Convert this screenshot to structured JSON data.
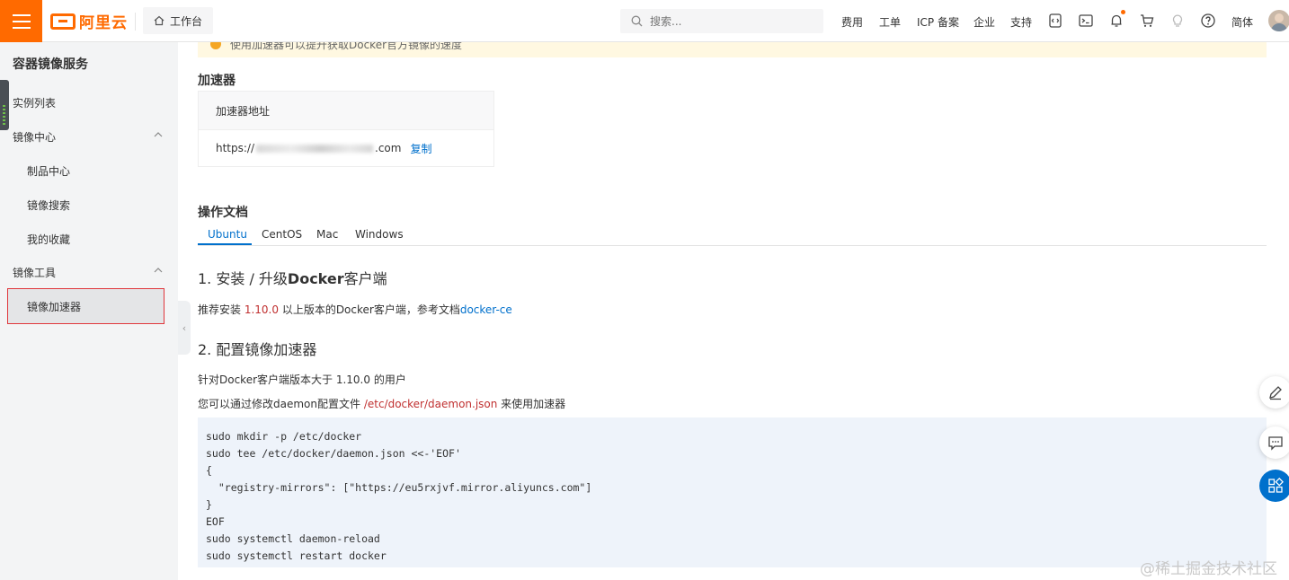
{
  "header": {
    "logo_text": "阿里云",
    "workbench_label": "工作台",
    "search_placeholder": "搜索...",
    "nav": [
      "费用",
      "工单",
      "ICP 备案",
      "企业",
      "支持"
    ],
    "lang_label": "简体",
    "brand_color": "#ff6a00"
  },
  "sidebar": {
    "title": "容器镜像服务",
    "items": [
      {
        "label": "实例列表"
      },
      {
        "label": "镜像中心"
      },
      {
        "label": "制品中心"
      },
      {
        "label": "镜像搜索"
      },
      {
        "label": "我的收藏"
      },
      {
        "label": "镜像工具"
      },
      {
        "label": "镜像加速器"
      }
    ],
    "active_color": "#e0363b"
  },
  "main": {
    "notice_text": "使用加速器可以提升获取Docker官方镜像的速度",
    "accelerator": {
      "title": "加速器",
      "column_header": "加速器地址",
      "url_prefix": "https://",
      "url_suffix": ".com",
      "copy_label": "复制"
    },
    "docs": {
      "title": "操作文档",
      "tabs": [
        "Ubuntu",
        "CentOS",
        "Mac",
        "Windows"
      ],
      "active_tab": "Ubuntu"
    },
    "step1": {
      "title_prefix": "1. 安装 / 升级",
      "title_bold": "Docker",
      "title_suffix": "客户端",
      "text_before": "推荐安装 ",
      "version": "1.10.0",
      "text_after": " 以上版本的Docker客户端，参考文档",
      "link": "docker-ce"
    },
    "step2": {
      "title": "2. 配置镜像加速器",
      "line1": "针对Docker客户端版本大于 1.10.0 的用户",
      "line2_before": "您可以通过修改daemon配置文件 ",
      "line2_path": "/etc/docker/daemon.json",
      "line2_after": " 来使用加速器"
    },
    "code": [
      "sudo mkdir -p /etc/docker",
      "sudo tee /etc/docker/daemon.json <<-'EOF'",
      "{",
      "  \"registry-mirrors\": [\"https://eu5rxjvf.mirror.aliyuncs.com\"]",
      "}",
      "EOF",
      "sudo systemctl daemon-reload",
      "sudo systemctl restart docker"
    ]
  },
  "watermark": "@稀土掘金技术社区"
}
